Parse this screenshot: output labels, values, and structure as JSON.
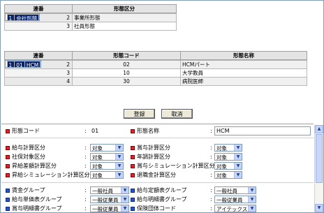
{
  "table1": {
    "headers": [
      "連番",
      "形態区分"
    ],
    "rows": [
      {
        "num": "1",
        "name": "会社形態",
        "selected": true
      },
      {
        "num": "2",
        "name": "事業所形態",
        "selected": false
      },
      {
        "num": "3",
        "name": "社員形態",
        "selected": false
      }
    ]
  },
  "table2": {
    "headers": [
      "連番",
      "形態コード",
      "形態名称"
    ],
    "rows": [
      {
        "num": "1",
        "code": "01",
        "name": "HCM",
        "selected": true
      },
      {
        "num": "2",
        "code": "02",
        "name": "HCMパート",
        "selected": false
      },
      {
        "num": "3",
        "code": "10",
        "name": "大学教員",
        "selected": false
      },
      {
        "num": "4",
        "code": "30",
        "name": "病院医師",
        "selected": false
      }
    ]
  },
  "buttons": {
    "register": "登録",
    "cancel": "取消"
  },
  "form": {
    "code_label": "形態コード",
    "code_value": "01",
    "name_label": "形態名称",
    "name_value": "HCM",
    "colon": ":",
    "group1": [
      {
        "label": "給与計算区分",
        "value": "対象",
        "label2": "賞与計算区分",
        "value2": "対象"
      },
      {
        "label": "社保対象区分",
        "value": "対象",
        "label2": "年調計算区分",
        "value2": "対象"
      },
      {
        "label": "昇給差額計算区分",
        "value": "対象",
        "label2": "賞与シミュレーション計算区分",
        "value2": "対象"
      },
      {
        "label": "昇給シミュレーション計算区分",
        "value": "対象",
        "label2": "退職金計算区分",
        "value2": "対象"
      }
    ],
    "group2": [
      {
        "label": "賃金グループ",
        "value": "一般社員",
        "label2": "給与定額表グループ",
        "value2": "一般社員"
      },
      {
        "label": "給与単価表グループ",
        "value": "一般従業員",
        "label2": "給与明細書グループ",
        "value2": "一般従業員"
      },
      {
        "label": "賞与明細書グループ",
        "value": "一般従業員",
        "label2": "保険団体コード",
        "value2": "アイテックス"
      }
    ]
  },
  "icons": {
    "required": "red-square-icon",
    "optional": "blue-square-icon",
    "dropdown": "chevron-down-icon"
  },
  "colors": {
    "selected_row": "#0a246a",
    "required_mark": "#e8202a",
    "optional_mark": "#2a52cc"
  }
}
